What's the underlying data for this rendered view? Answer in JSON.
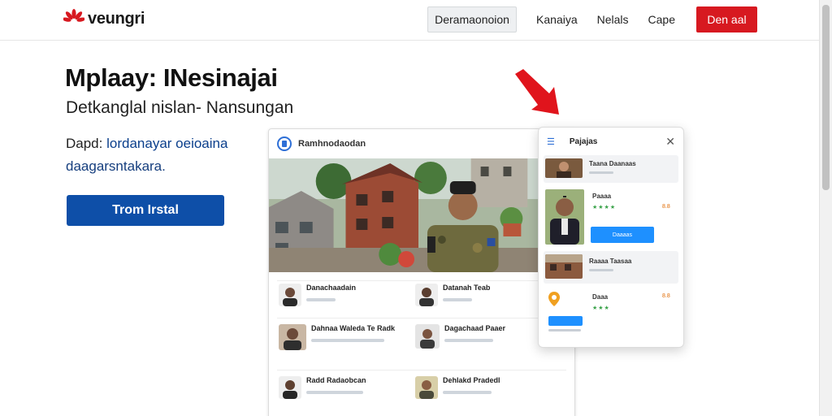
{
  "header": {
    "brand": "veungri",
    "nav_secondary": "Deramaonoion",
    "nav_links": [
      "Kanaiya",
      "Nelals",
      "Cape"
    ],
    "nav_primary": "Den aal"
  },
  "hero": {
    "title": "Mplaay: INesinajai",
    "subtitle": "Detkanglal nislan- Nansungan",
    "desc_line1_prefix": "Dapd:",
    "desc_line1_highlight": "lordanayar oeioaina",
    "desc_line2": "daagarsntakara.",
    "cta": "Trom Irstal"
  },
  "mockup": {
    "title": "Ramhnodaodan",
    "feed": [
      {
        "text": "Danachaadain"
      },
      {
        "text": "Datanah Teab"
      },
      {
        "text": "Dahnaa Waleda Te Radk"
      },
      {
        "text": "Dagachaad Paaer"
      },
      {
        "text": "Radd Radaobcan"
      },
      {
        "text": "Dehlakd Pradedl"
      }
    ]
  },
  "panel": {
    "title": "Pajajas",
    "items": [
      {
        "label": "Taana Daanaas",
        "num": ""
      },
      {
        "label": "Paaaa",
        "num": "8.8"
      },
      {
        "label": "Raaaa Taasaa",
        "num": ""
      },
      {
        "label": "Daaa",
        "num": "8.8"
      }
    ],
    "button": "Daaaas"
  },
  "colors": {
    "brand_red": "#d71920",
    "cta_blue": "#0e4fa8",
    "panel_button": "#1e90ff"
  }
}
